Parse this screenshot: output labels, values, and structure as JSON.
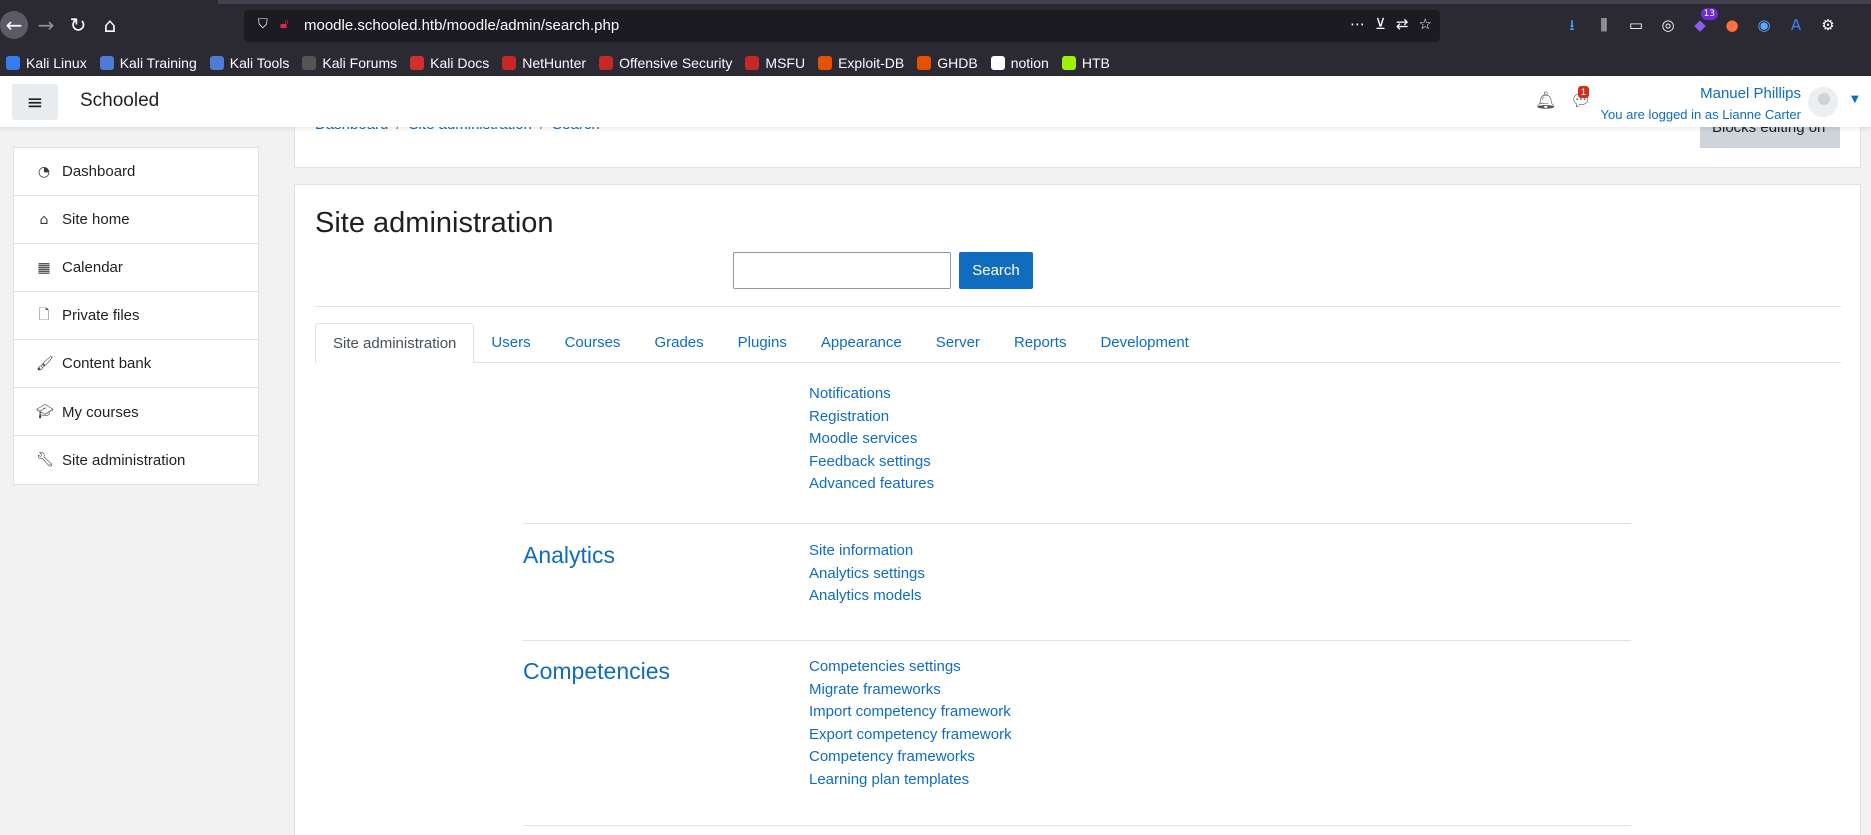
{
  "browser": {
    "url": "moodle.schooled.htb/moodle/admin/search.php",
    "toolbar_badge": "13",
    "bookmarks": [
      {
        "label": "Kali Linux",
        "color": "#367bf0"
      },
      {
        "label": "Kali Training",
        "color": "#4d7bd6"
      },
      {
        "label": "Kali Tools",
        "color": "#4d7bd6"
      },
      {
        "label": "Kali Forums",
        "color": "#555555"
      },
      {
        "label": "Kali Docs",
        "color": "#d32f2f"
      },
      {
        "label": "NetHunter",
        "color": "#c62828"
      },
      {
        "label": "Offensive Security",
        "color": "#c62828"
      },
      {
        "label": "MSFU",
        "color": "#c62828"
      },
      {
        "label": "Exploit-DB",
        "color": "#e65100"
      },
      {
        "label": "GHDB",
        "color": "#e65100"
      },
      {
        "label": "notion",
        "color": "#ffffff"
      },
      {
        "label": "HTB",
        "color": "#9fef00"
      }
    ]
  },
  "navbar": {
    "brand": "Schooled",
    "message_count": "1",
    "user_name": "Manuel Phillips",
    "logged_in_as": "You are logged in as Lianne Carter"
  },
  "drawer": {
    "items": [
      {
        "label": "Dashboard",
        "icon": "dashboard-icon"
      },
      {
        "label": "Site home",
        "icon": "home-icon"
      },
      {
        "label": "Calendar",
        "icon": "calendar-icon"
      },
      {
        "label": "Private files",
        "icon": "file-icon"
      },
      {
        "label": "Content bank",
        "icon": "paintbrush-icon"
      },
      {
        "label": "My courses",
        "icon": "graduation-cap-icon"
      }
    ],
    "admin": {
      "label": "Site administration",
      "icon": "wrench-icon"
    }
  },
  "header": {
    "breadcrumb": [
      "Dashboard",
      "Site administration",
      "Search"
    ],
    "blocks_button": "Blocks editing on"
  },
  "main": {
    "title": "Site administration",
    "search_value": "",
    "search_button": "Search",
    "tabs": [
      "Site administration",
      "Users",
      "Courses",
      "Grades",
      "Plugins",
      "Appearance",
      "Server",
      "Reports",
      "Development"
    ],
    "general_links": [
      "Notifications",
      "Registration",
      "Moodle services",
      "Feedback settings",
      "Advanced features"
    ],
    "sections": [
      {
        "title": "Analytics",
        "links": [
          "Site information",
          "Analytics settings",
          "Analytics models"
        ]
      },
      {
        "title": "Competencies",
        "links": [
          "Competencies settings",
          "Migrate frameworks",
          "Import competency framework",
          "Export competency framework",
          "Competency frameworks",
          "Learning plan templates"
        ]
      }
    ]
  },
  "colors": {
    "accent": "#0f6cbf",
    "badge_red": "#ca3120"
  }
}
